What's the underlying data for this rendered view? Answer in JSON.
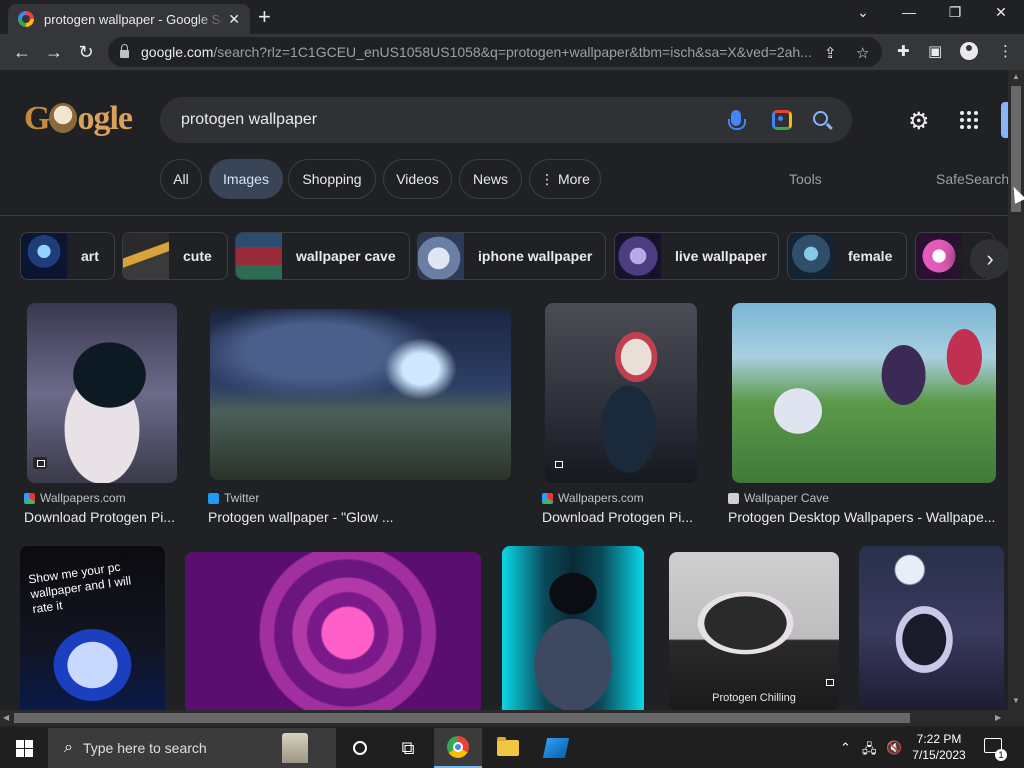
{
  "browser": {
    "tab_title": "protogen wallpaper - Google Search",
    "new_tab": "+",
    "url_host": "google.com",
    "url_rest": "/search?rlz=1C1GCEU_enUS1058US1058&q=protogen+wallpaper&tbm=isch&sa=X&ved=2ah..."
  },
  "search": {
    "query": "protogen wallpaper"
  },
  "filters": {
    "all": "All",
    "images": "Images",
    "shopping": "Shopping",
    "videos": "Videos",
    "news": "News",
    "more": "⋮ More",
    "tools": "Tools",
    "safesearch": "SafeSearch"
  },
  "chips": [
    {
      "label": "art"
    },
    {
      "label": "cute"
    },
    {
      "label": "wallpaper cave"
    },
    {
      "label": "iphone wallpaper"
    },
    {
      "label": "live wallpaper"
    },
    {
      "label": "female"
    },
    {
      "label": ""
    }
  ],
  "results": [
    {
      "source": "Wallpapers.com",
      "caption": "Download Protogen Pi..."
    },
    {
      "source": "Twitter",
      "caption": "Protogen wallpaper - \"Glow ..."
    },
    {
      "source": "Wallpapers.com",
      "caption": "Download Protogen Pi..."
    },
    {
      "source": "Wallpaper Cave",
      "caption": "Protogen Desktop Wallpapers - Wallpape..."
    }
  ],
  "row2": {
    "overlay_text": "Show me your pc wallpaper and I will rate it",
    "chilling_text": "Protogen Chilling"
  },
  "taskbar": {
    "search_placeholder": "Type here to search",
    "time": "7:22 PM",
    "date": "7/15/2023",
    "notification_count": "1"
  }
}
